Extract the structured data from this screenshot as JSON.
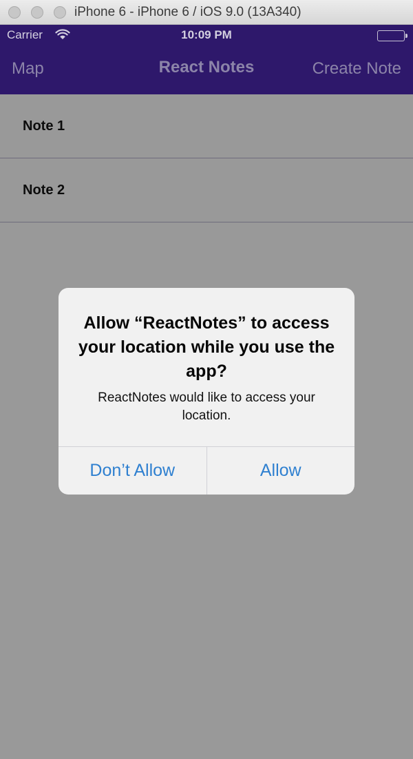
{
  "window": {
    "title": "iPhone 6 - iPhone 6 / iOS 9.0 (13A340)"
  },
  "status_bar": {
    "carrier": "Carrier",
    "time": "10:09 PM",
    "wifi_icon": "wifi-icon",
    "battery_icon": "battery-icon",
    "battery_level": 1.0
  },
  "nav_bar": {
    "left_label": "Map",
    "title": "React Notes",
    "right_label": "Create Note",
    "background": "#2e186b"
  },
  "notes": [
    {
      "title": "Note 1"
    },
    {
      "title": "Note 2"
    }
  ],
  "alert": {
    "title": "Allow “ReactNotes” to access your location while you use the app?",
    "message": "ReactNotes would like to access your location.",
    "buttons": {
      "deny": "Don’t Allow",
      "allow": "Allow"
    },
    "button_color": "#2f80d0"
  }
}
